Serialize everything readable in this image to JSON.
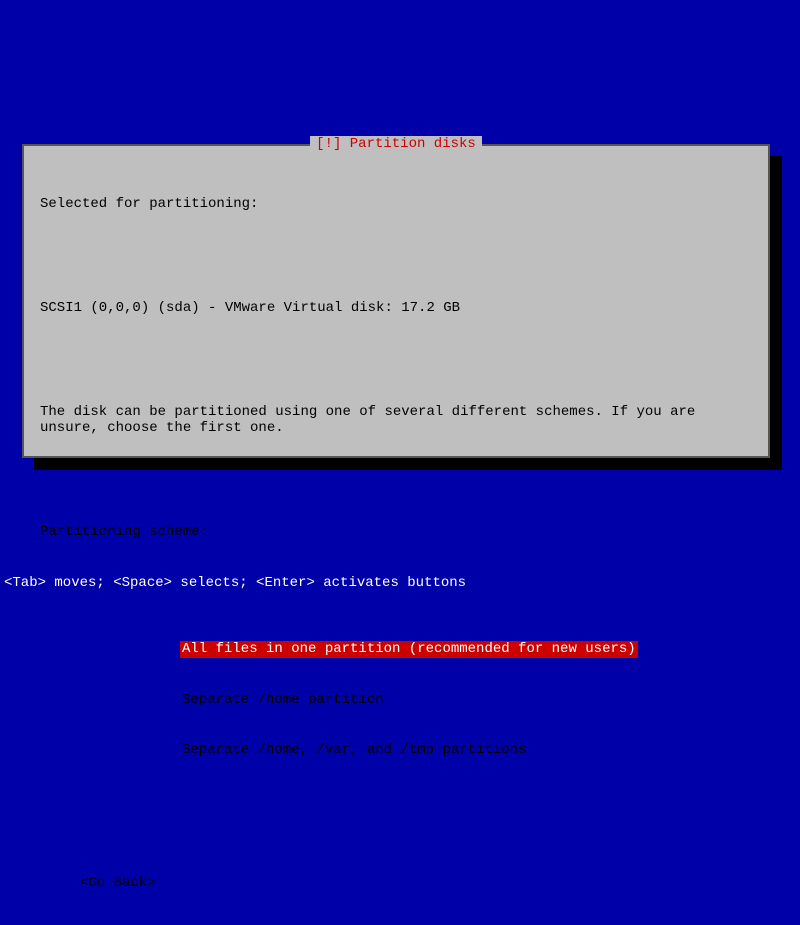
{
  "dialog": {
    "title": "[!] Partition disks",
    "selected_for_label": "Selected for partitioning:",
    "disk_info": "SCSI1 (0,0,0) (sda) - VMware Virtual disk: 17.2 GB",
    "description": "The disk can be partitioned using one of several different schemes. If you are unsure, choose the first one.",
    "scheme_label": "Partitioning scheme:",
    "options": [
      "All files in one partition (recommended for new users)",
      "Separate /home partition",
      "Separate /home, /var, and /tmp partitions"
    ],
    "selected_index": 0,
    "go_back": "<Go Back>"
  },
  "hint": "<Tab> moves; <Space> selects; <Enter> activates buttons"
}
